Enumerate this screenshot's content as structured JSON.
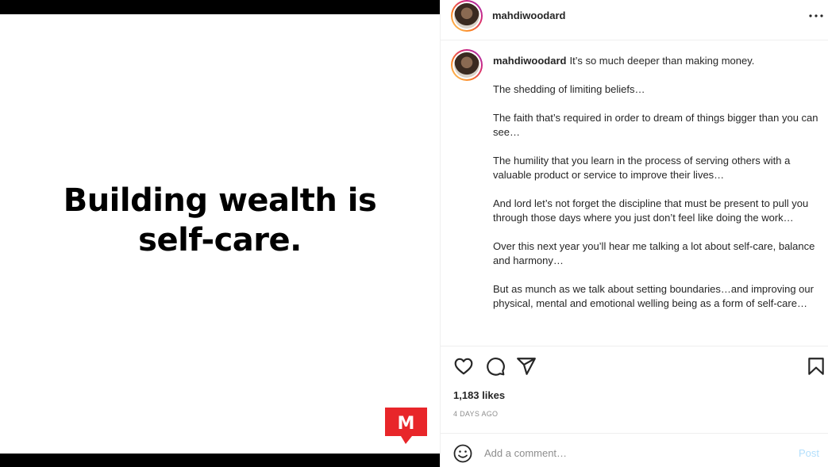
{
  "media": {
    "headline_line1": "Building wealth is",
    "headline_line2": "self-care.",
    "logo_letter": "M",
    "logo_color": "#e8262a"
  },
  "header": {
    "username": "mahdiwoodard",
    "more_icon": "more-horizontal-icon"
  },
  "caption": {
    "username": "mahdiwoodard",
    "first_line": "It’s so much deeper than making money.",
    "paragraphs": [
      "The shedding of limiting beliefs…",
      "The faith that’s required in order to dream of things bigger than you can see…",
      "The humility that you learn in the process of serving others with a valuable product or service to improve their lives…",
      "And lord let’s not forget the discipline that must be present to pull you through those days where you just don’t feel like doing the work…",
      "Over this next year you’ll hear me talking a lot about self-care, balance and harmony…",
      "But as munch as we talk about setting boundaries…and improving our physical, mental and emotional welling being as a form of self-care…"
    ]
  },
  "actions": {
    "like_icon": "heart-icon",
    "comment_icon": "comment-icon",
    "share_icon": "send-icon",
    "save_icon": "bookmark-icon"
  },
  "stats": {
    "likes": "1,183 likes",
    "timestamp": "4 DAYS AGO"
  },
  "comment_box": {
    "placeholder": "Add a comment…",
    "post_label": "Post",
    "emoji_icon": "emoji-icon"
  },
  "colors": {
    "accent_post_disabled": "#b2dffc",
    "border": "#efefef",
    "text": "#262626",
    "muted": "#8e8e8e"
  }
}
